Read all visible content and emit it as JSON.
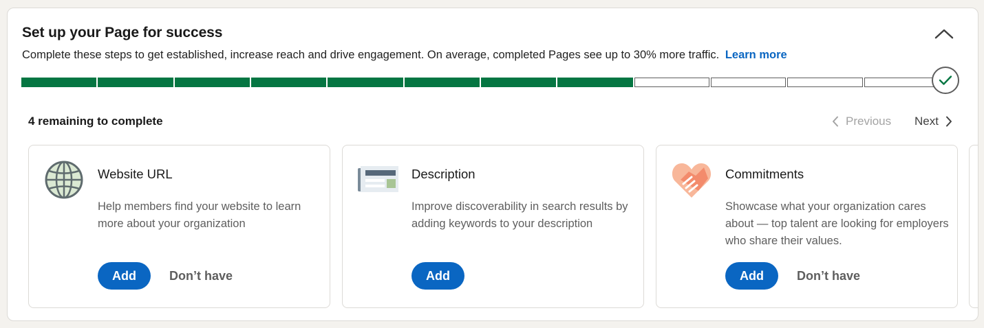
{
  "header": {
    "title": "Set up your Page for success",
    "subtitle": "Complete these steps to get established, increase reach and drive engagement. On average, completed Pages see up to 30% more traffic.",
    "learn_more": "Learn more"
  },
  "progress": {
    "total_steps": 12,
    "completed_steps": 8
  },
  "status": {
    "remaining": "4 remaining to complete"
  },
  "nav": {
    "previous": "Previous",
    "next": "Next"
  },
  "cards": [
    {
      "icon": "globe-icon",
      "title": "Website URL",
      "description": "Help members find your website to learn more about your organization",
      "add_label": "Add",
      "dont_have_label": "Don’t have"
    },
    {
      "icon": "newspaper-icon",
      "title": "Description",
      "description": "Improve discoverability in search results by adding keywords to your description",
      "add_label": "Add"
    },
    {
      "icon": "handshake-heart-icon",
      "title": "Commitments",
      "description": "Showcase what your organization cares about — top talent are looking for employers who share their values.",
      "add_label": "Add",
      "dont_have_label": "Don’t have"
    }
  ],
  "colors": {
    "accent": "#0a66c2",
    "progress_done": "#057642",
    "background": "#f4f2ee"
  }
}
